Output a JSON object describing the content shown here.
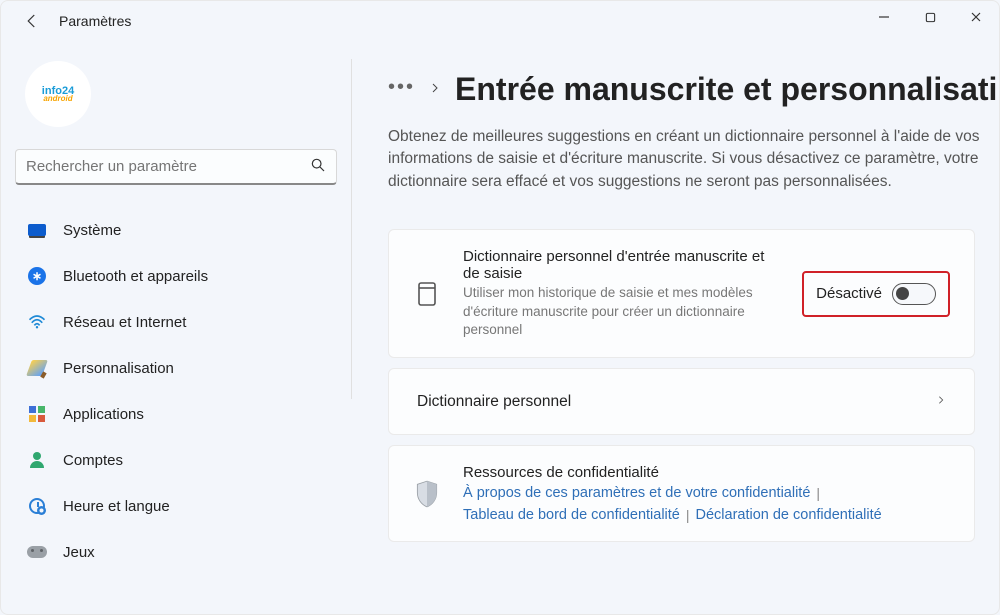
{
  "window": {
    "title": "Paramètres"
  },
  "avatar": {
    "line1": "info24",
    "line2": "android"
  },
  "search": {
    "placeholder": "Rechercher un paramètre"
  },
  "sidebar": {
    "items": [
      {
        "label": "Système"
      },
      {
        "label": "Bluetooth et appareils"
      },
      {
        "label": "Réseau et Internet"
      },
      {
        "label": "Personnalisation"
      },
      {
        "label": "Applications"
      },
      {
        "label": "Comptes"
      },
      {
        "label": "Heure et langue"
      },
      {
        "label": "Jeux"
      }
    ]
  },
  "page": {
    "title": "Entrée manuscrite et personnalisati",
    "description": "Obtenez de meilleures suggestions en créant un dictionnaire personnel à l'aide de vos informations de saisie et d'écriture manuscrite. Si vous désactivez ce paramètre, votre dictionnaire sera effacé et vos suggestions ne seront pas personnalisées."
  },
  "cards": {
    "dictSetting": {
      "title": "Dictionnaire personnel d'entrée manuscrite et de saisie",
      "subtitle": "Utiliser mon historique de saisie et mes modèles d'écriture manuscrite pour créer un dictionnaire personnel",
      "toggleLabel": "Désactivé",
      "toggleState": "off"
    },
    "personalDict": {
      "title": "Dictionnaire personnel"
    },
    "privacy": {
      "title": "Ressources de confidentialité",
      "links": [
        "À propos de ces paramètres et de votre confidentialité",
        "Tableau de bord de confidentialité",
        "Déclaration de confidentialité"
      ]
    }
  }
}
